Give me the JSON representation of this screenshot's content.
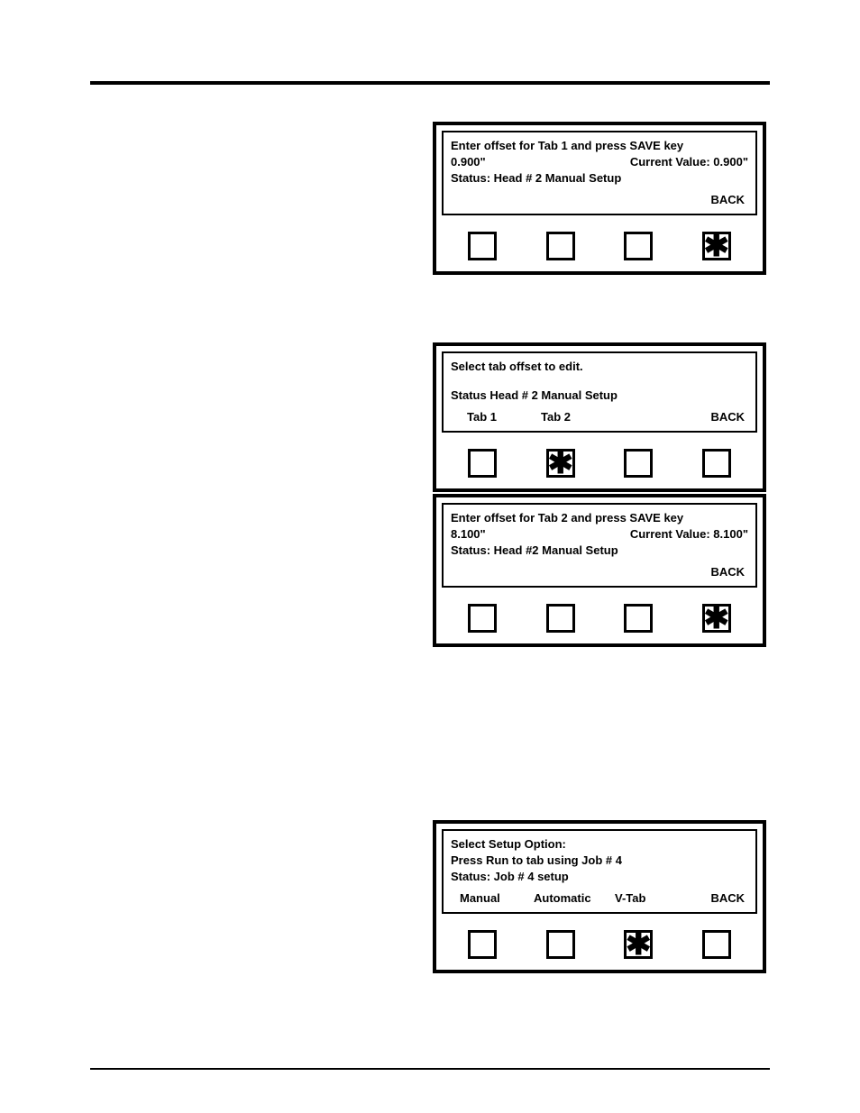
{
  "panel1": {
    "prompt": "Enter offset for Tab 1 and press SAVE key",
    "value": "0.900\"",
    "current_value_label": "Current Value:",
    "current_value": "0.900\"",
    "status": "Status: Head # 2 Manual Setup",
    "back": "BACK",
    "star_index": 3
  },
  "panel2": {
    "prompt": "Select tab offset to edit.",
    "status": "Status Head # 2 Manual Setup",
    "labels": [
      "Tab 1",
      "Tab 2",
      "",
      "BACK"
    ],
    "star_index": 1
  },
  "panel3": {
    "prompt": "Enter offset for Tab 2 and press SAVE key",
    "value": "8.100\"",
    "current_value_label": "Current Value:",
    "current_value": "8.100\"",
    "status": "Status: Head #2 Manual Setup",
    "back": "BACK",
    "star_index": 3
  },
  "panel4": {
    "l1": "Select Setup Option:",
    "l2": "Press Run to tab using Job # 4",
    "l3": "Status:  Job # 4 setup",
    "labels": [
      "Manual",
      "Automatic",
      "V-Tab",
      "BACK"
    ],
    "star_index": 2
  },
  "asterisk_glyph": "✱"
}
